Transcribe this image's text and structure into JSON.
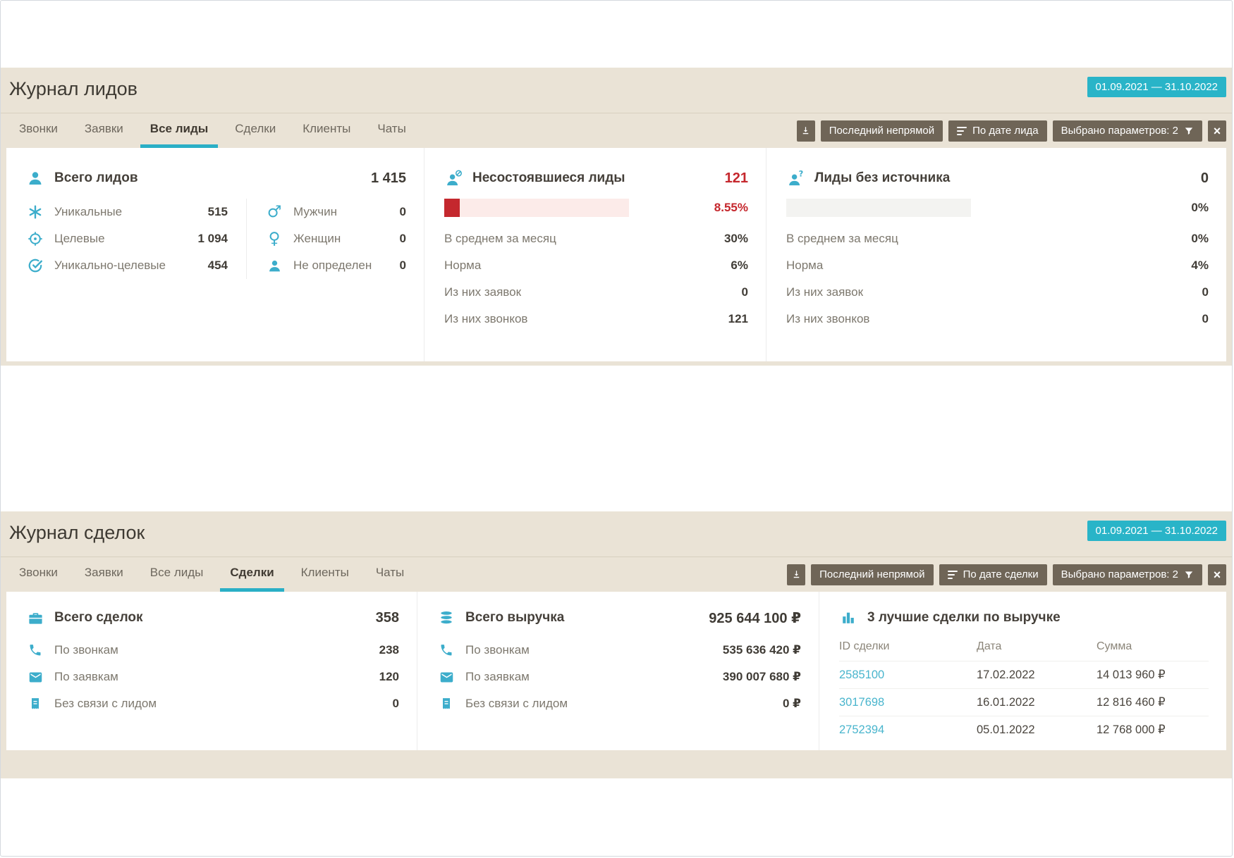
{
  "colors": {
    "accent_teal": "#2bb2c7",
    "alert_red": "#c5272d",
    "toolbar_button_brown": "#6f6557",
    "section_background_beige": "#eae3d6",
    "link_teal": "#49b5cd"
  },
  "leads": {
    "title": "Журнал лидов",
    "date_range": "01.09.2021 — 31.10.2022",
    "tabs": [
      "Звонки",
      "Заявки",
      "Все лиды",
      "Сделки",
      "Клиенты",
      "Чаты"
    ],
    "active_tab": "Все лиды",
    "toolbar": {
      "export_icon": "download-icon",
      "attribution": "Последний непрямой",
      "sort": "По дате лида",
      "params": "Выбрано параметров: 2",
      "close": "×"
    },
    "total": {
      "title": "Всего лидов",
      "value": "1 415",
      "left_rows": [
        {
          "icon": "asterisk-icon",
          "label": "Уникальные",
          "value": "515"
        },
        {
          "icon": "target-icon",
          "label": "Целевые",
          "value": "1 094"
        },
        {
          "icon": "unique-target-icon",
          "label": "Уникально-целевые",
          "value": "454"
        }
      ],
      "right_rows": [
        {
          "icon": "male-icon",
          "label": "Мужчин",
          "value": "0"
        },
        {
          "icon": "female-icon",
          "label": "Женщин",
          "value": "0"
        },
        {
          "icon": "person-icon",
          "label": "Не определен",
          "value": "0"
        }
      ]
    },
    "failed": {
      "title": "Несостоявшиеся лиды",
      "value": "121",
      "bar_width": "8.55%",
      "percent": "8.55%",
      "rows": [
        {
          "label": "В среднем за месяц",
          "value": "30%"
        },
        {
          "label": "Норма",
          "value": "6%"
        },
        {
          "label": "Из них заявок",
          "value": "0"
        },
        {
          "label": "Из них звонков",
          "value": "121"
        }
      ]
    },
    "no_source": {
      "title": "Лиды без источника",
      "value": "0",
      "bar_width": "0%",
      "percent": "0%",
      "rows": [
        {
          "label": "В среднем за месяц",
          "value": "0%"
        },
        {
          "label": "Норма",
          "value": "4%"
        },
        {
          "label": "Из них заявок",
          "value": "0"
        },
        {
          "label": "Из них звонков",
          "value": "0"
        }
      ]
    }
  },
  "deals": {
    "title": "Журнал сделок",
    "date_range": "01.09.2021 — 31.10.2022",
    "tabs": [
      "Звонки",
      "Заявки",
      "Все лиды",
      "Сделки",
      "Клиенты",
      "Чаты"
    ],
    "active_tab": "Сделки",
    "toolbar": {
      "export_icon": "download-icon",
      "attribution": "Последний непрямой",
      "sort": "По дате сделки",
      "params": "Выбрано параметров: 2",
      "close": "×"
    },
    "total": {
      "title": "Всего сделок",
      "value": "358",
      "rows": [
        {
          "icon": "phone-icon",
          "label": "По звонкам",
          "value": "238"
        },
        {
          "icon": "mail-icon",
          "label": "По заявкам",
          "value": "120"
        },
        {
          "icon": "receipt-icon",
          "label": "Без связи с лидом",
          "value": "0"
        }
      ]
    },
    "revenue": {
      "title": "Всего выручка",
      "value": "925 644 100 ₽",
      "rows": [
        {
          "icon": "phone-icon",
          "label": "По звонкам",
          "value": "535 636 420 ₽"
        },
        {
          "icon": "mail-icon",
          "label": "По заявкам",
          "value": "390 007 680 ₽"
        },
        {
          "icon": "receipt-icon",
          "label": "Без связи с лидом",
          "value": "0 ₽"
        }
      ]
    },
    "top_deals": {
      "title": "3 лучшие сделки по выручке",
      "columns": [
        "ID сделки",
        "Дата",
        "Сумма"
      ],
      "rows": [
        {
          "id": "2585100",
          "date": "17.02.2022",
          "amount": "14 013 960 ₽"
        },
        {
          "id": "3017698",
          "date": "16.01.2022",
          "amount": "12 816 460 ₽"
        },
        {
          "id": "2752394",
          "date": "05.01.2022",
          "amount": "12 768 000 ₽"
        }
      ]
    }
  }
}
